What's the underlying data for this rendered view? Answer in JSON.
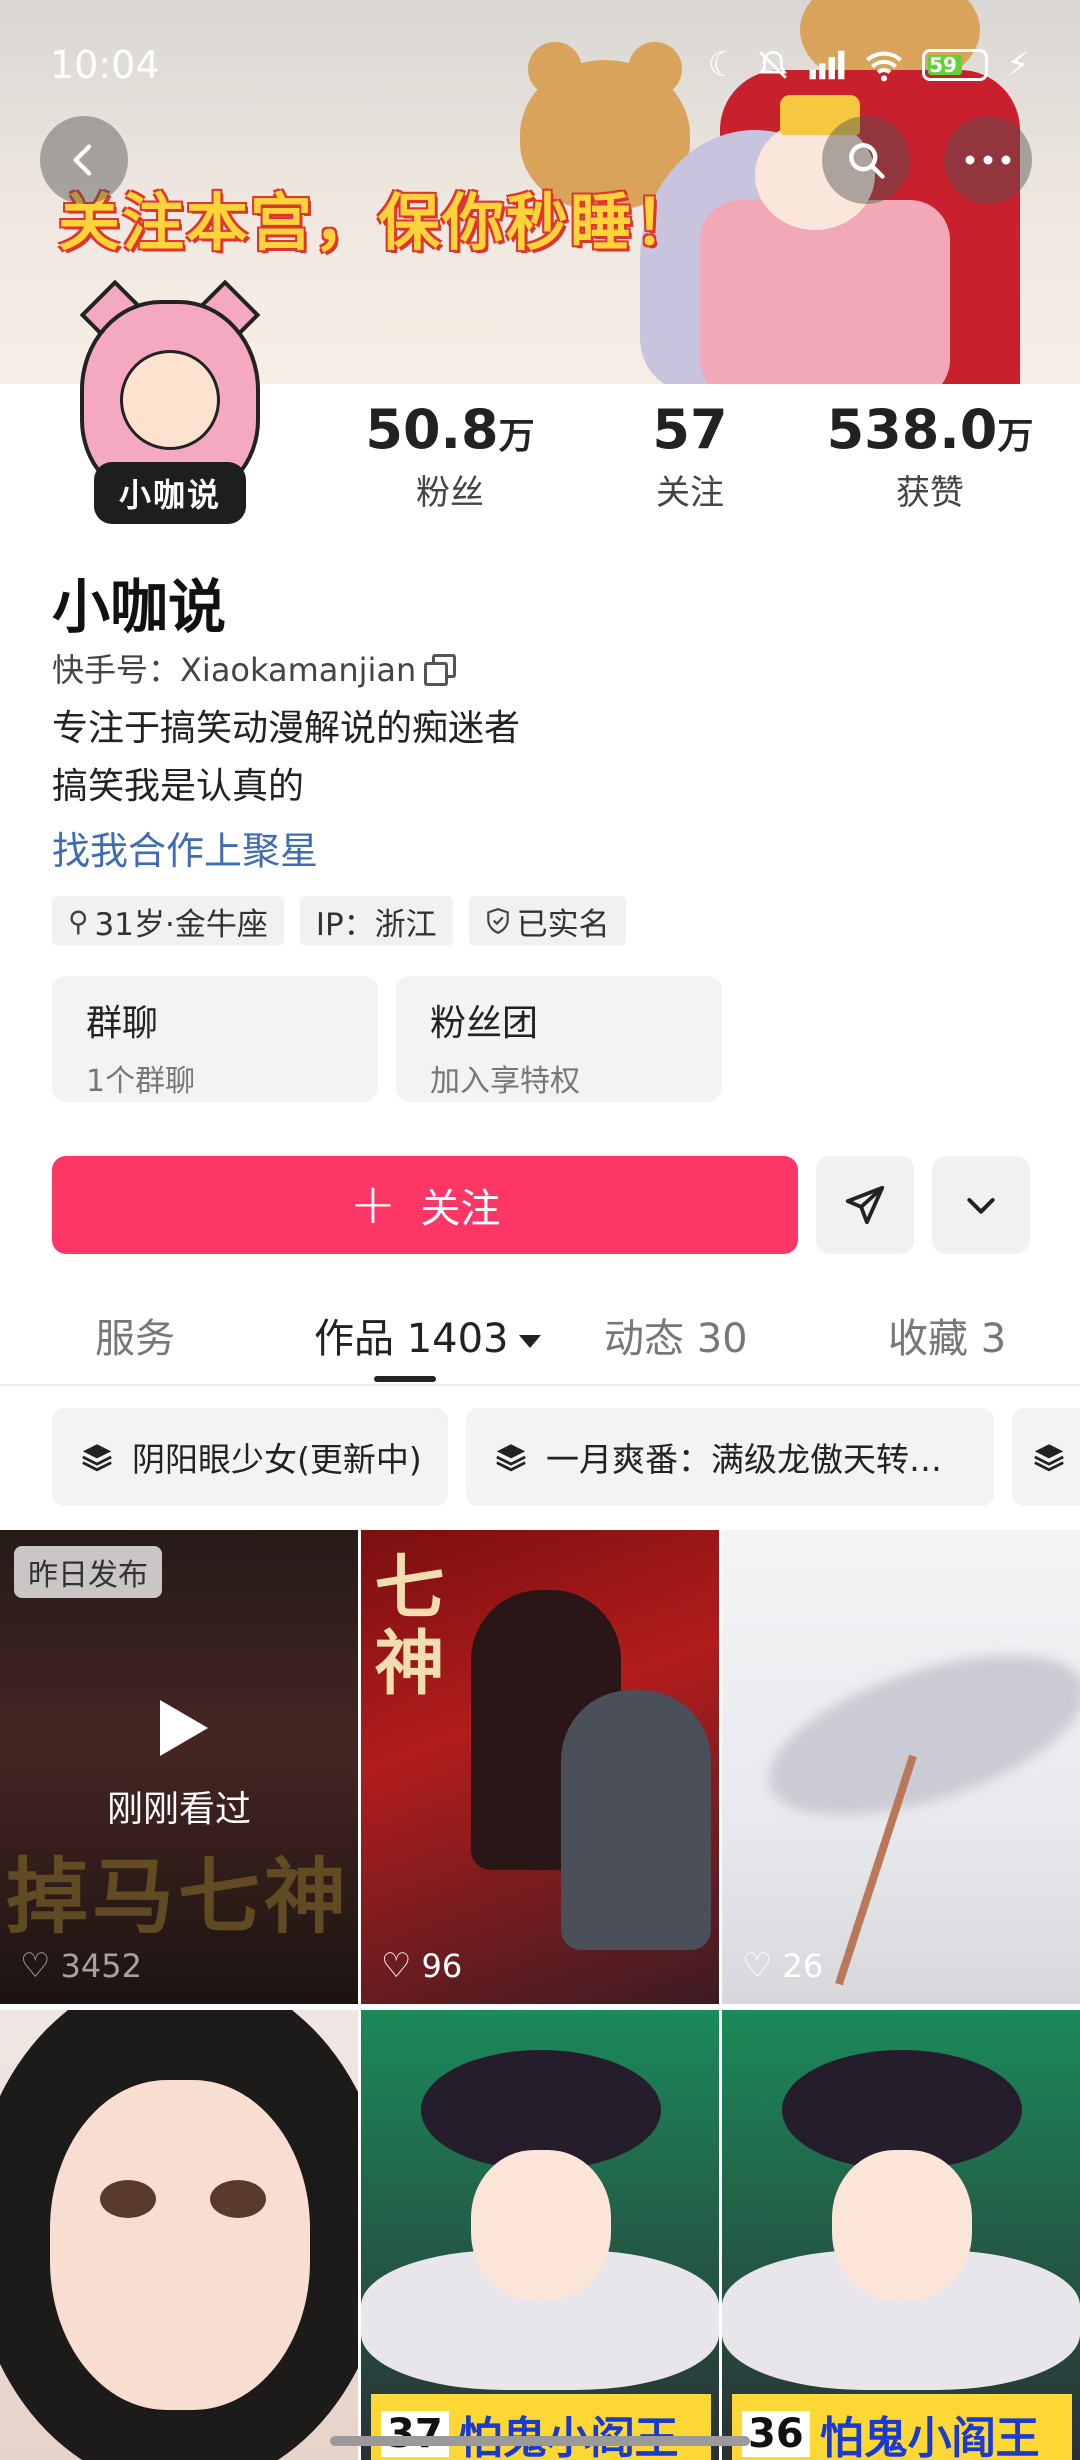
{
  "status_bar": {
    "time": "10:04",
    "battery": "59"
  },
  "banner": {
    "slogan": "关注本宫，保你秒睡！"
  },
  "profile": {
    "avatar_text": "小咖说",
    "stats": [
      {
        "num": "50.8",
        "unit": "万",
        "label": "粉丝"
      },
      {
        "num": "57",
        "unit": "",
        "label": "关注"
      },
      {
        "num": "538.0",
        "unit": "万",
        "label": "获赞"
      }
    ],
    "name": "小咖说",
    "kuaishou_id": "快手号：Xiaokamanjian",
    "bio_line1": "专注于搞笑动漫解说的痴迷者",
    "bio_line2": "搞笑我是认真的",
    "link": "找我合作上聚星",
    "tags": [
      "31岁·金牛座",
      "IP：浙江",
      "已实名"
    ],
    "cards": [
      {
        "title": "群聊",
        "sub": "1个群聊"
      },
      {
        "title": "粉丝团",
        "sub": "加入享特权"
      }
    ],
    "follow_label": "关注"
  },
  "tabs": [
    {
      "label": "服务"
    },
    {
      "label": "作品 1403"
    },
    {
      "label": "动态 30"
    },
    {
      "label": "收藏 3"
    }
  ],
  "chips": [
    "阴阳眼少女(更新中)",
    "一月爽番：满级龙傲天转…"
  ],
  "grid": {
    "c1_badge": "昨日发布",
    "c1_overlay": "刚刚看过",
    "c1_title": "掉马七神",
    "c1_likes": "3452",
    "c2_title": "七神",
    "c2_likes": "96",
    "c3_likes": "26",
    "c5_ep": "37",
    "c5_title": "怕鬼小阎王",
    "c6_ep": "36",
    "c6_title": "怕鬼小阎王"
  },
  "colors": {
    "accent": "#fe3666",
    "link": "#3f6db3"
  }
}
